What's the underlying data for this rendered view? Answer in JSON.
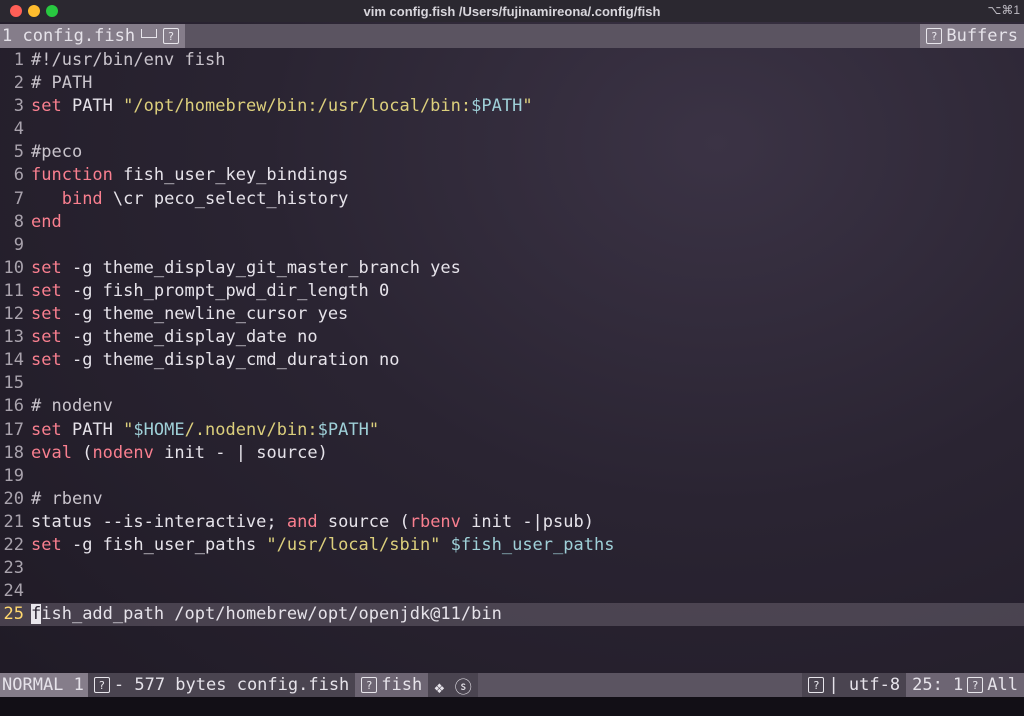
{
  "window": {
    "title": "vim config.fish /Users/fujinamireona/.config/fish",
    "shortcut": "⌥⌘1"
  },
  "tabline": {
    "active_tab": "1 config.fish",
    "buffers_label": "Buffers"
  },
  "editor": {
    "current_line": 25,
    "lines": [
      {
        "n": "1",
        "code": "#!/usr/bin/env fish"
      },
      {
        "n": "2",
        "code": "# PATH"
      },
      {
        "n": "3",
        "code": "set PATH \"/opt/homebrew/bin:/usr/local/bin:$PATH\""
      },
      {
        "n": "4",
        "code": ""
      },
      {
        "n": "5",
        "code": "#peco"
      },
      {
        "n": "6",
        "code": "function fish_user_key_bindings"
      },
      {
        "n": "7",
        "code": "   bind \\cr peco_select_history"
      },
      {
        "n": "8",
        "code": "end"
      },
      {
        "n": "9",
        "code": ""
      },
      {
        "n": "10",
        "code": "set -g theme_display_git_master_branch yes"
      },
      {
        "n": "11",
        "code": "set -g fish_prompt_pwd_dir_length 0"
      },
      {
        "n": "12",
        "code": "set -g theme_newline_cursor yes"
      },
      {
        "n": "13",
        "code": "set -g theme_display_date no"
      },
      {
        "n": "14",
        "code": "set -g theme_display_cmd_duration no"
      },
      {
        "n": "15",
        "code": ""
      },
      {
        "n": "16",
        "code": "# nodenv"
      },
      {
        "n": "17",
        "code": "set PATH \"$HOME/.nodenv/bin:$PATH\""
      },
      {
        "n": "18",
        "code": "eval (nodenv init - | source)"
      },
      {
        "n": "19",
        "code": ""
      },
      {
        "n": "20",
        "code": "# rbenv"
      },
      {
        "n": "21",
        "code": "status --is-interactive; and source (rbenv init -|psub)"
      },
      {
        "n": "22",
        "code": "set -g fish_user_paths \"/usr/local/sbin\" $fish_user_paths"
      },
      {
        "n": "23",
        "code": ""
      },
      {
        "n": "24",
        "code": ""
      },
      {
        "n": "25",
        "code": "fish_add_path /opt/homebrew/opt/openjdk@11/bin"
      }
    ]
  },
  "statusline": {
    "mode": "NORMAL 1",
    "file_info": "- 577 bytes config.fish",
    "filetype": "fish",
    "symbols": "❖ ⓢ",
    "encoding": "| utf-8",
    "position": "25:  1",
    "scroll": "All"
  },
  "colors": {
    "keyword": "#f97f8f",
    "string": "#dccf7c",
    "variable": "#9fd0d8",
    "current_line_number": "#ffd86e"
  }
}
